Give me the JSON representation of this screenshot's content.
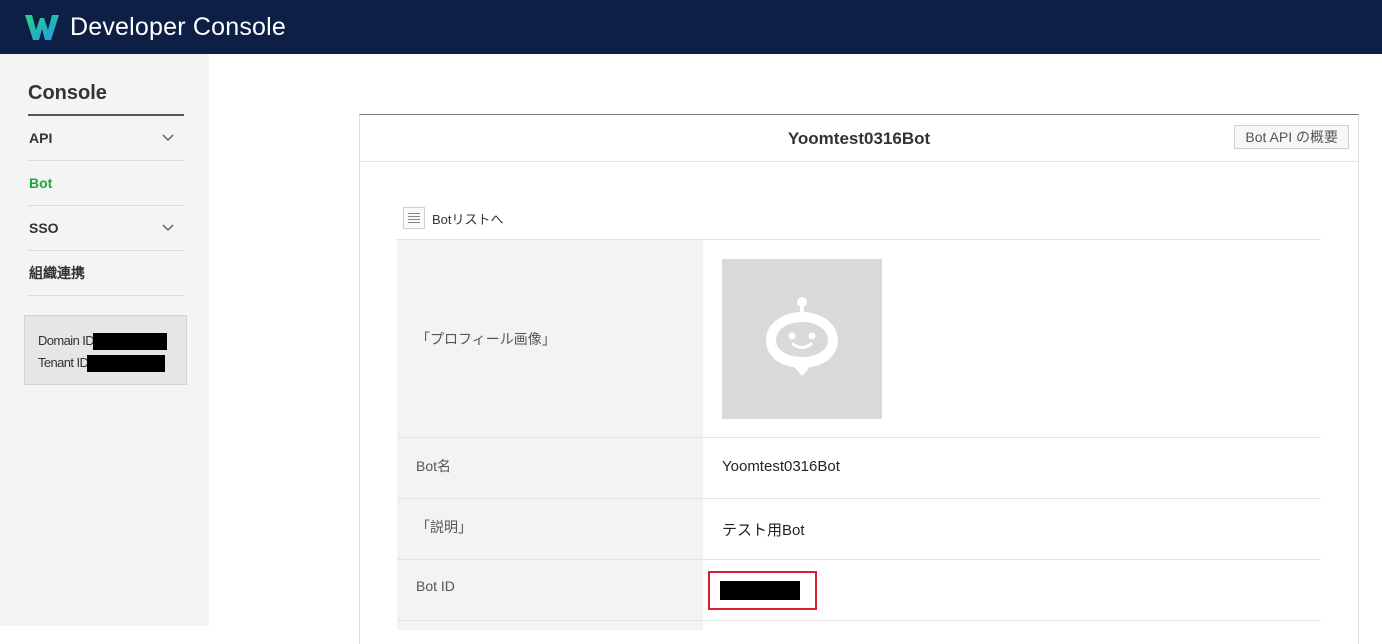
{
  "header": {
    "title": "Developer Console",
    "logo": "works-logo-icon"
  },
  "sidebar": {
    "title": "Console",
    "items": [
      {
        "label": "API",
        "has_chevron": true
      },
      {
        "label": "Bot",
        "active": true
      },
      {
        "label": "SSO",
        "has_chevron": true
      },
      {
        "label": "組織連携"
      }
    ],
    "info": {
      "domain_label": "Domain ID :",
      "tenant_label": "Tenant ID :"
    }
  },
  "panel": {
    "title": "Yoomtest0316Bot",
    "api_button": "Bot API の概要",
    "list_link": "Botリストへ",
    "rows": {
      "profile_label": "「プロフィール画像」",
      "name_label": "Bot名",
      "name_value": "Yoomtest0316Bot",
      "desc_label": "「説明」",
      "desc_value": "テスト用Bot",
      "id_label": "Bot ID"
    }
  },
  "colors": {
    "header_bg": "#0e1f45",
    "active_green": "#1fa83a",
    "highlight_red": "#d8202f"
  }
}
